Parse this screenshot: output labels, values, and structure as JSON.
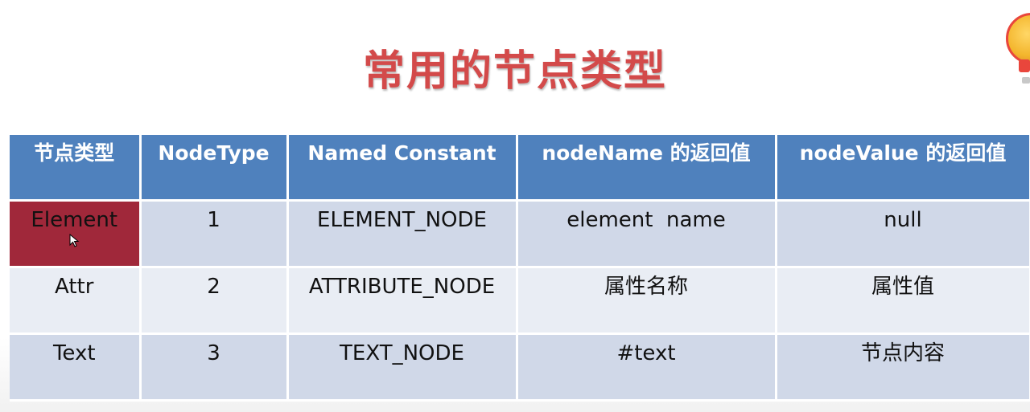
{
  "title": "常用的节点类型",
  "table": {
    "headers": [
      "节点类型",
      "NodeType",
      "Named Constant",
      "nodeName 的返回值",
      "nodeValue 的返回值"
    ],
    "rows": [
      [
        "Element",
        "1",
        "ELEMENT_NODE",
        "element  name",
        "null"
      ],
      [
        "Attr",
        "2",
        "ATTRIBUTE_NODE",
        "属性名称",
        "属性值"
      ],
      [
        "Text",
        "3",
        "TEXT_NODE",
        "#text",
        "节点内容"
      ]
    ]
  },
  "colors": {
    "title": "#d34a4a",
    "header_bg": "#4f81bd",
    "row_dark": "#d0d8e8",
    "row_light": "#e9edf4",
    "highlight": "#a0283a"
  }
}
